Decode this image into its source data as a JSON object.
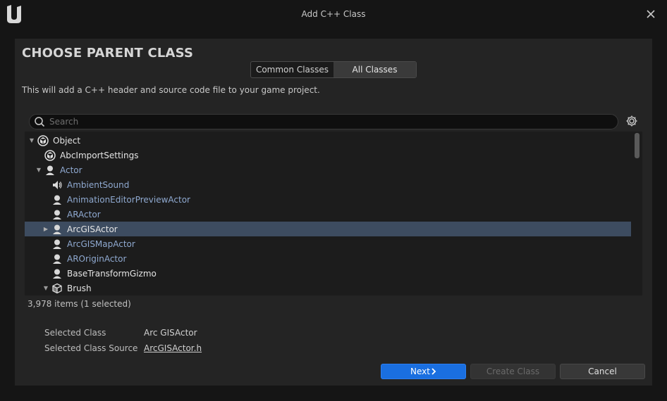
{
  "window": {
    "title": "Add C++ Class"
  },
  "panel": {
    "heading": "CHOOSE PARENT CLASS",
    "tabs": [
      {
        "label": "Common Classes",
        "active": false
      },
      {
        "label": "All Classes",
        "active": true
      }
    ],
    "description": "This will add a C++ header and source code file to your game project.",
    "search_placeholder": "Search"
  },
  "tree": {
    "items": [
      {
        "label": "Object",
        "icon": "object-icon",
        "expanded": true,
        "color": "white"
      },
      {
        "label": "AbcImportSettings",
        "icon": "object-icon",
        "color": "white"
      },
      {
        "label": "Actor",
        "icon": "actor-icon",
        "expanded": true,
        "color": "blue"
      },
      {
        "label": "AmbientSound",
        "icon": "speaker-icon",
        "color": "blue"
      },
      {
        "label": "AnimationEditorPreviewActor",
        "icon": "actor-icon",
        "color": "blue"
      },
      {
        "label": "ARActor",
        "icon": "actor-icon",
        "color": "blue"
      },
      {
        "label": "ArcGISActor",
        "icon": "actor-icon",
        "collapsed": true,
        "selected": true,
        "color": "white"
      },
      {
        "label": "ArcGISMapActor",
        "icon": "actor-icon",
        "color": "blue"
      },
      {
        "label": "AROriginActor",
        "icon": "actor-icon",
        "color": "blue"
      },
      {
        "label": "BaseTransformGizmo",
        "icon": "actor-icon",
        "color": "white"
      },
      {
        "label": "Brush",
        "icon": "brush-cube-icon",
        "expanded": true,
        "color": "white"
      }
    ]
  },
  "status": {
    "count": "3,978 items (1 selected)"
  },
  "selection": {
    "class_label": "Selected Class",
    "class_value": "Arc GISActor",
    "source_label": "Selected Class Source",
    "source_value": "ArcGISActor.h"
  },
  "buttons": {
    "next": "Next",
    "create": "Create Class",
    "cancel": "Cancel"
  },
  "colors": {
    "accent": "#1a6fe0",
    "selected_row": "#3d4c60",
    "link_blue": "#8fa9d0"
  }
}
